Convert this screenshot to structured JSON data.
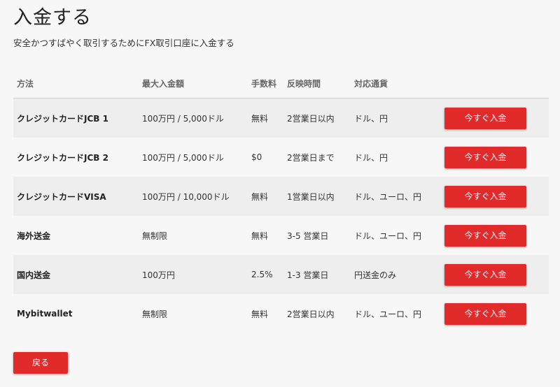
{
  "page": {
    "title": "入金する",
    "subtitle": "安全かつすばやく取引するためにFX取引口座に入金する"
  },
  "table": {
    "headers": {
      "method": "方法",
      "max_deposit": "最大入金額",
      "fee": "手数料",
      "processing_time": "反映時間",
      "currencies": "対応通貨"
    },
    "rows": [
      {
        "method": "クレジットカードJCB 1",
        "max_deposit": "100万円 / 5,000ドル",
        "fee": "無料",
        "processing_time": "2営業日以内",
        "currencies": "ドル、円",
        "button": "今すぐ入金"
      },
      {
        "method": "クレジットカードJCB 2",
        "max_deposit": "100万円 / 5,000ドル",
        "fee": "$0",
        "processing_time": "2営業日まで",
        "currencies": "ドル、円",
        "button": "今すぐ入金"
      },
      {
        "method": "クレジットカードVISA",
        "max_deposit": "100万円 / 10,000ドル",
        "fee": "無料",
        "processing_time": "1営業日以内",
        "currencies": "ドル、ユーロ、円",
        "button": "今すぐ入金"
      },
      {
        "method": "海外送金",
        "max_deposit": "無制限",
        "fee": "無料",
        "processing_time": "3-5 営業日",
        "currencies": "ドル、ユーロ、円",
        "button": "今すぐ入金"
      },
      {
        "method": "国内送金",
        "max_deposit": "100万円",
        "fee": "2.5%",
        "processing_time": "1-3 営業日",
        "currencies": "円送金のみ",
        "button": "今すぐ入金"
      },
      {
        "method": "Mybitwallet",
        "max_deposit": "無制限",
        "fee": "無料",
        "processing_time": "2営業日以内",
        "currencies": "ドル、ユーロ、円",
        "button": "今すぐ入金"
      }
    ]
  },
  "footer": {
    "back_label": "戻る"
  },
  "colors": {
    "accent": "#e12a2a",
    "row_stripe": "#eeeeee",
    "background": "#f7f7f7"
  }
}
